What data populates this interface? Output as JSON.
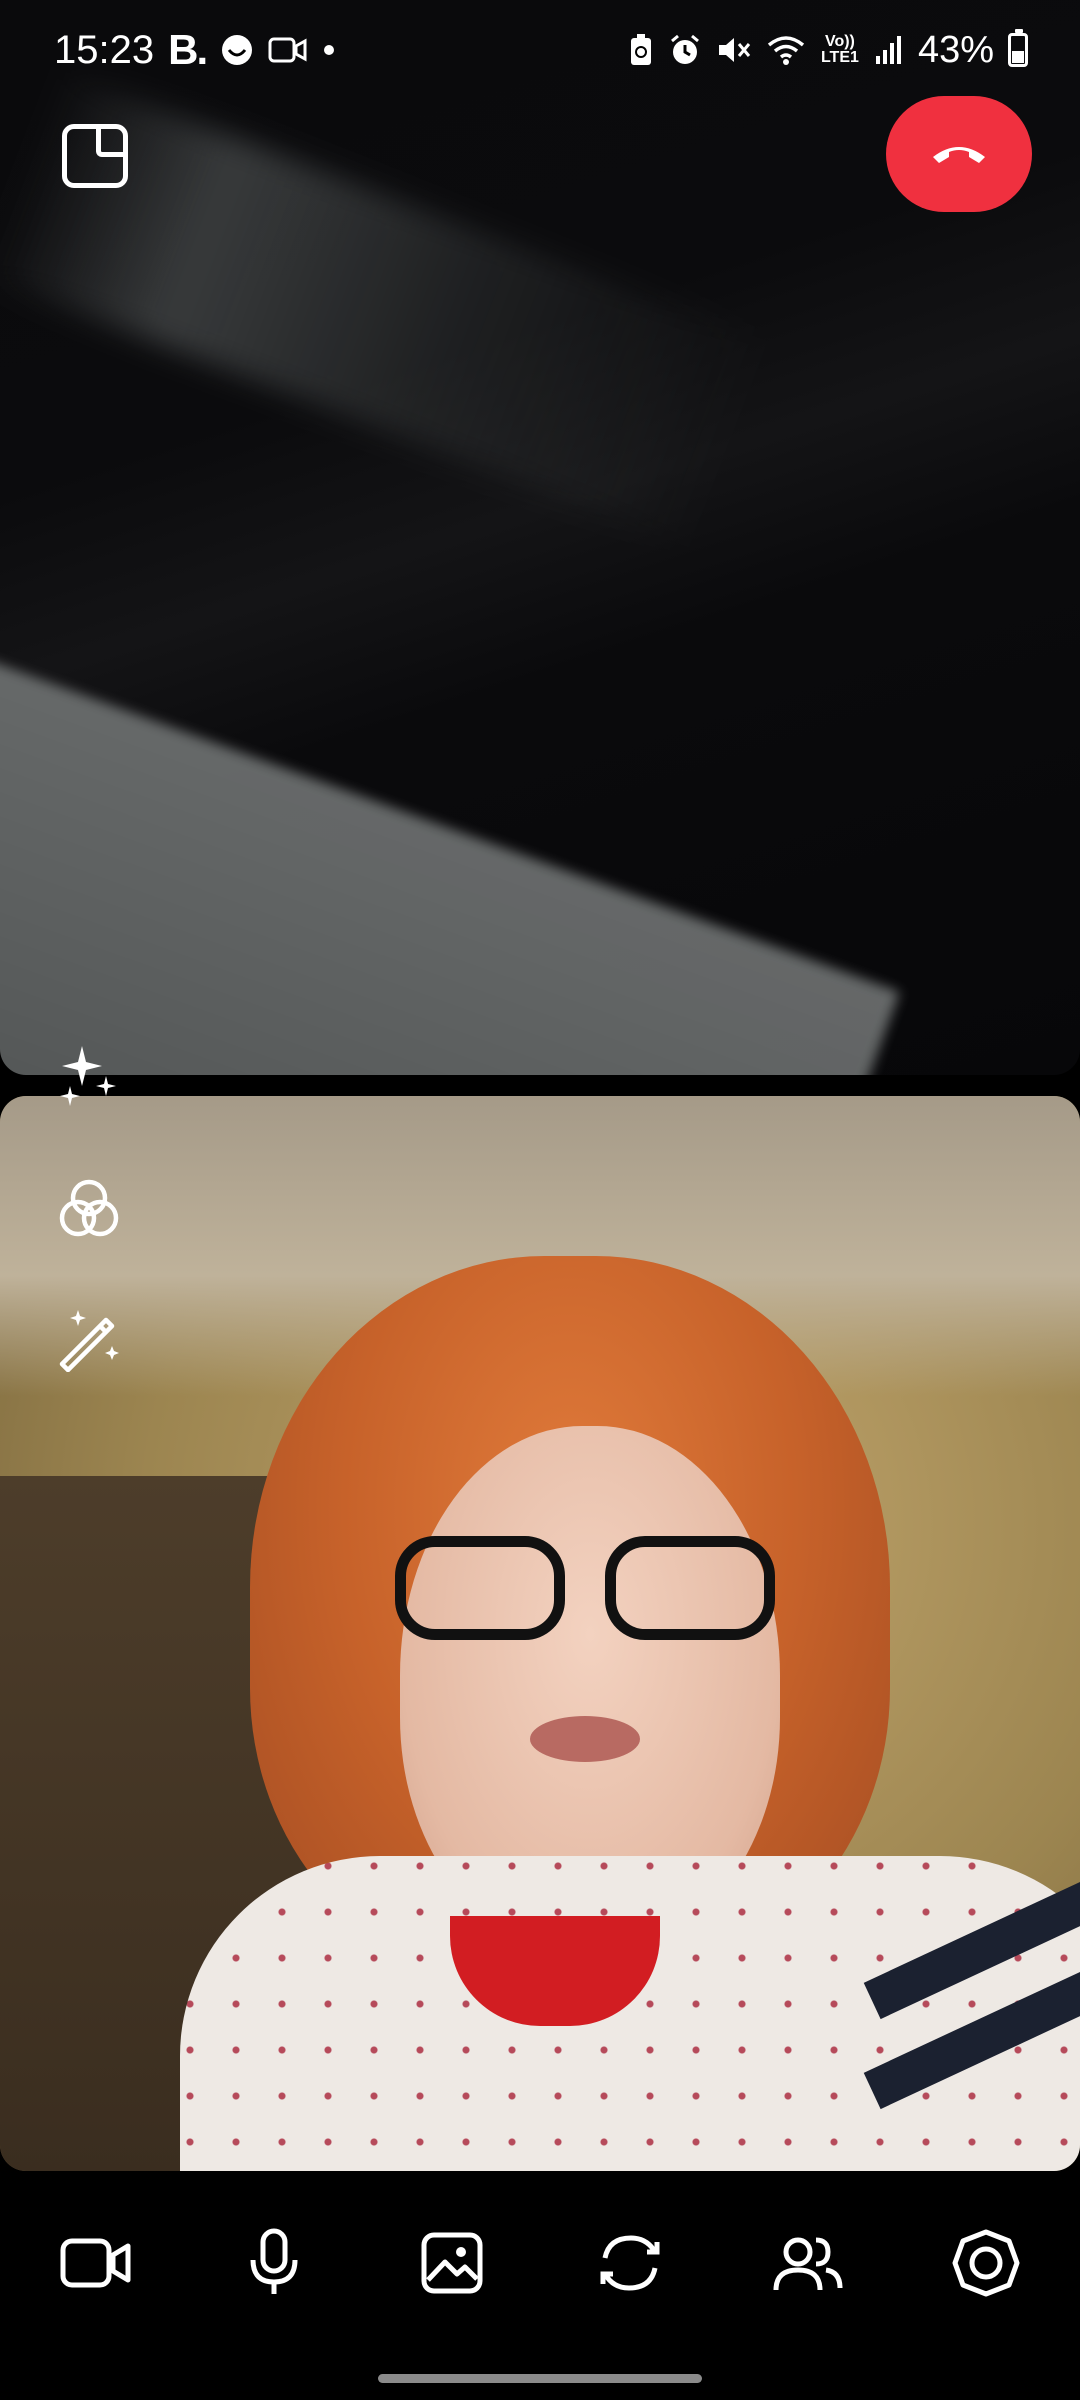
{
  "status_bar": {
    "time": "15:23",
    "left_badge": "B.",
    "battery_percent": "43%",
    "network_label": "Vo)) LTE1",
    "battery_level": 0.43
  },
  "call": {
    "end_call_color": "#f0303f"
  },
  "toolbar": {
    "items": [
      "video-camera-icon",
      "microphone-icon",
      "image-icon",
      "switch-camera-icon",
      "participants-icon",
      "settings-icon"
    ]
  },
  "effects": {
    "items": [
      "sparkles-icon",
      "filters-icon",
      "magic-wand-icon"
    ]
  }
}
